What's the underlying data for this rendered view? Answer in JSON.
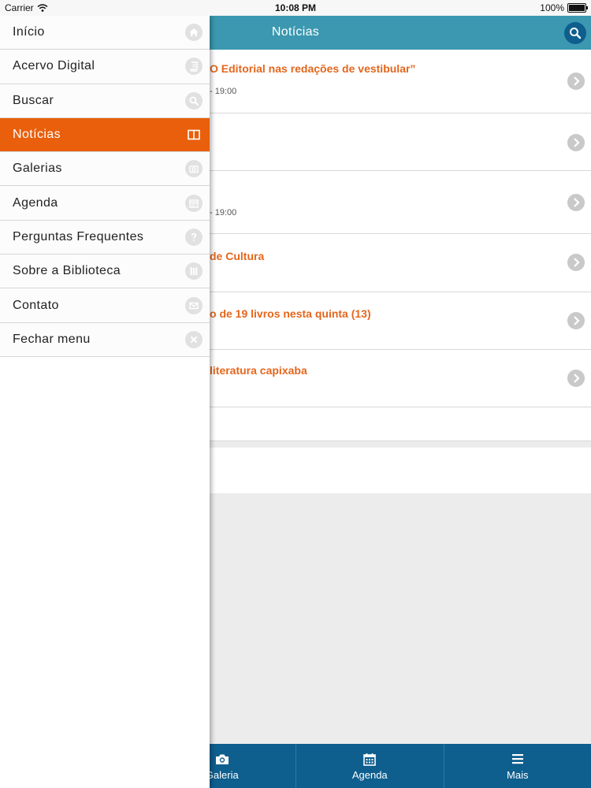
{
  "status_bar": {
    "carrier": "Carrier",
    "time": "10:08 PM",
    "battery": "100%"
  },
  "header": {
    "title": "Notícias"
  },
  "news": [
    {
      "title": "O Editorial nas redações de vestibular”",
      "date": "- 19:00"
    },
    {
      "title": "",
      "date": ""
    },
    {
      "title": "",
      "date": "- 19:00"
    },
    {
      "title": "de Cultura",
      "date": ""
    },
    {
      "title": "o de 19 livros nesta quinta (13)",
      "date": ""
    },
    {
      "title": "literatura capixaba",
      "date": ""
    }
  ],
  "menu": {
    "items": [
      {
        "label": "Início",
        "icon": "home-icon"
      },
      {
        "label": "Acervo Digital",
        "icon": "book-icon"
      },
      {
        "label": "Buscar",
        "icon": "search-icon"
      },
      {
        "label": "Notícias",
        "icon": "newspaper-icon",
        "active": true
      },
      {
        "label": "Galerias",
        "icon": "camera-icon"
      },
      {
        "label": "Agenda",
        "icon": "calendar-icon"
      },
      {
        "label": "Perguntas Frequentes",
        "icon": "question-icon"
      },
      {
        "label": "Sobre a Biblioteca",
        "icon": "library-icon"
      },
      {
        "label": "Contato",
        "icon": "mail-icon"
      },
      {
        "label": "Fechar menu",
        "icon": "close-icon"
      }
    ]
  },
  "tabbar": {
    "tabs": [
      {
        "label": "",
        "icon": "",
        "active": true
      },
      {
        "label": "Galeria",
        "icon": "camera-icon"
      },
      {
        "label": "Agenda",
        "icon": "calendar-icon"
      },
      {
        "label": "Mais",
        "icon": "menu-icon"
      }
    ]
  },
  "colors": {
    "header": "#3b98b0",
    "accent_orange": "#e95f0c",
    "tabbar_blue": "#0e5e8e",
    "news_title": "#e4661c"
  }
}
